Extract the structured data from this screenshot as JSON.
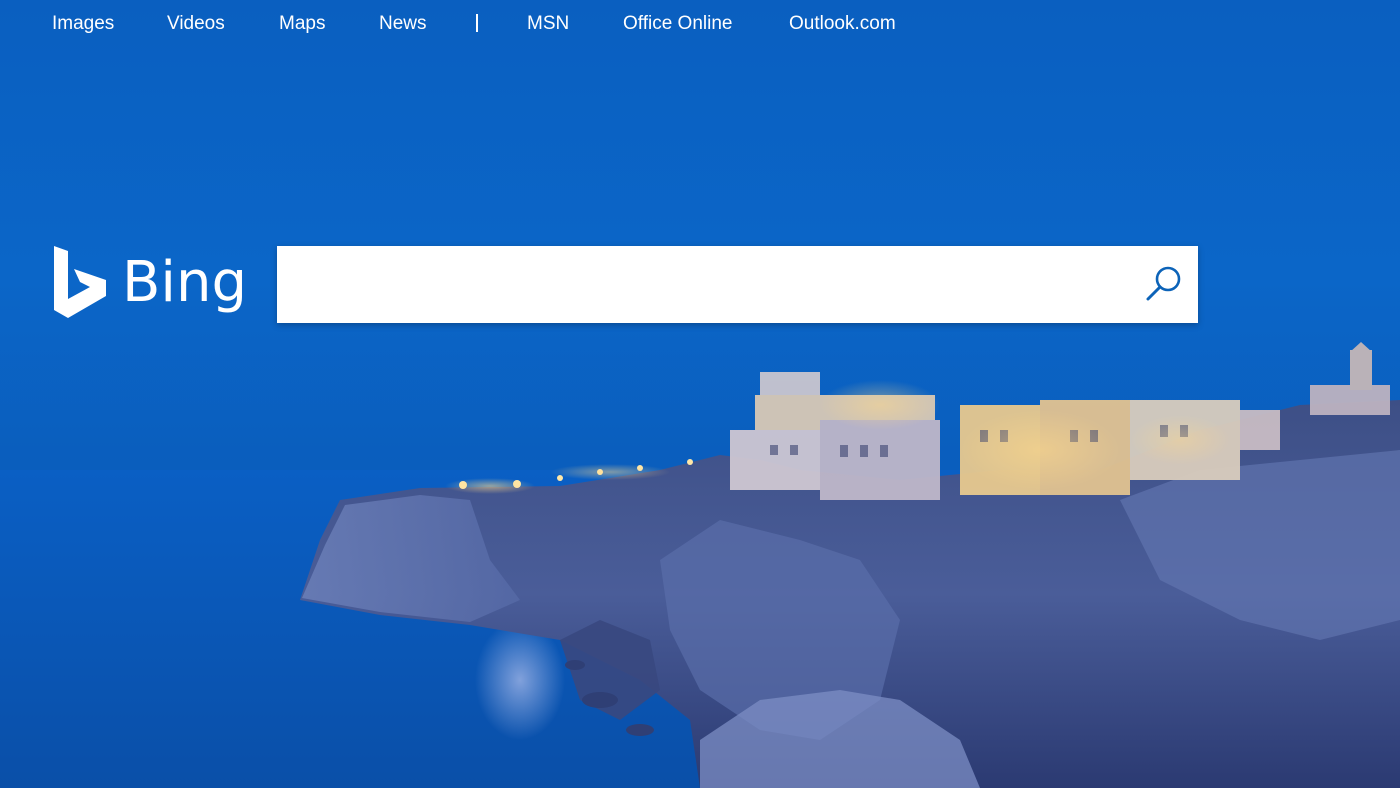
{
  "nav": {
    "links": [
      {
        "label": "Images"
      },
      {
        "label": "Videos"
      },
      {
        "label": "Maps"
      },
      {
        "label": "News"
      },
      {
        "label": "MSN"
      },
      {
        "label": "Office Online"
      },
      {
        "label": "Outlook.com"
      }
    ]
  },
  "logo": {
    "text": "Bing",
    "icon": "bing-b-icon"
  },
  "search": {
    "value": "",
    "placeholder": "",
    "button_icon": "search-icon"
  },
  "background": {
    "description_icon": "coastal-cliff-town-night-image"
  },
  "colors": {
    "sky": "#0b66c8",
    "search_icon": "#0c63b8",
    "text": "#ffffff"
  }
}
